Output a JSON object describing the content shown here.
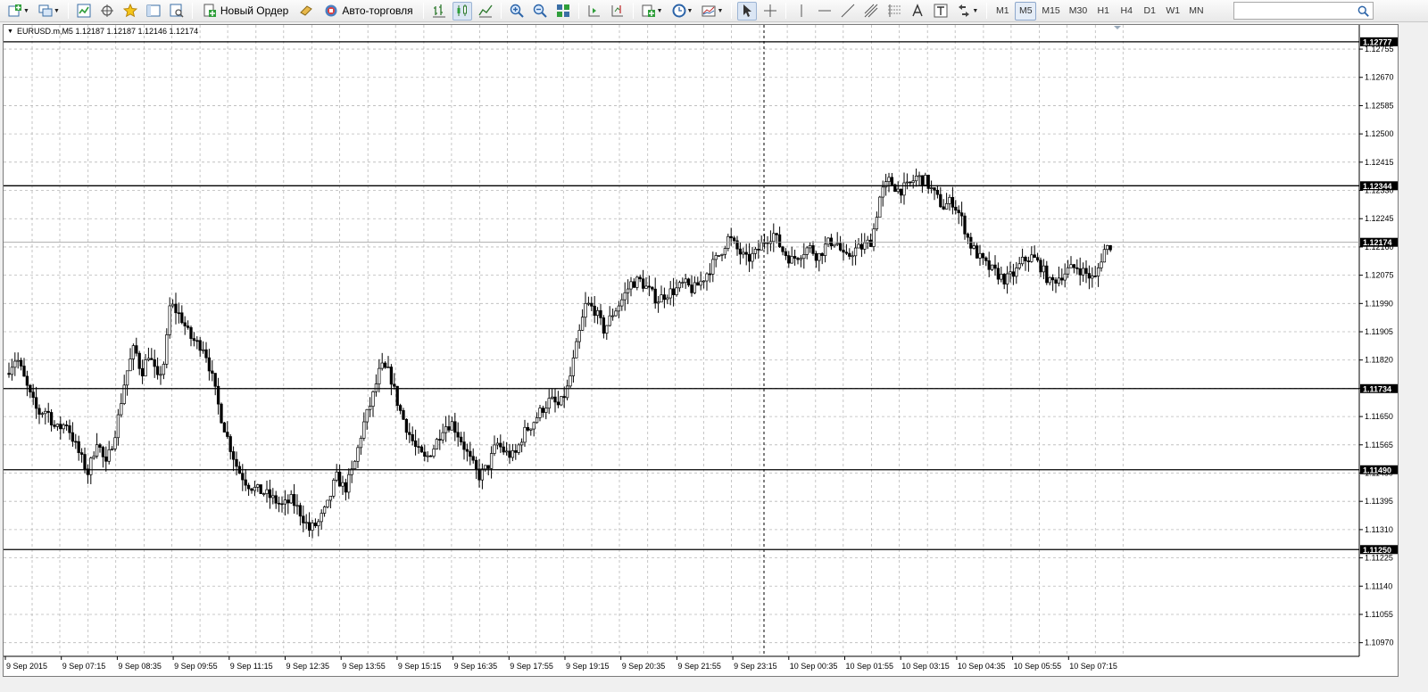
{
  "toolbar": {
    "new_order_label": "Новый Ордер",
    "auto_trading_label": "Авто-торговля",
    "timeframes": [
      "M1",
      "M5",
      "M15",
      "M30",
      "H1",
      "H4",
      "D1",
      "W1",
      "MN"
    ],
    "active_timeframe": "M5"
  },
  "chart": {
    "header_text": "EURUSD.m,M5  1.12187 1.12187 1.12146 1.12174",
    "symbol": "EURUSD.m",
    "timeframe": "M5",
    "ohlc": [
      "1.12187",
      "1.12187",
      "1.12146",
      "1.12174"
    ]
  },
  "chart_data": {
    "type": "candlestick",
    "title": "EURUSD.m,M5",
    "y_axis_ticks": [
      "1.12755",
      "1.12670",
      "1.12585",
      "1.12500",
      "1.12415",
      "1.12330",
      "1.12245",
      "1.12160",
      "1.12075",
      "1.11990",
      "1.11905",
      "1.11820",
      "1.11735",
      "1.11650",
      "1.11565",
      "1.11480",
      "1.11395",
      "1.11310",
      "1.11225",
      "1.11140",
      "1.11055",
      "1.10970"
    ],
    "x_axis_ticks": [
      "9 Sep 2015",
      "9 Sep 07:15",
      "9 Sep 08:35",
      "9 Sep 09:55",
      "9 Sep 11:15",
      "9 Sep 12:35",
      "9 Sep 13:55",
      "9 Sep 15:15",
      "9 Sep 16:35",
      "9 Sep 17:55",
      "9 Sep 19:15",
      "9 Sep 20:35",
      "9 Sep 21:55",
      "9 Sep 23:15",
      "10 Sep 00:35",
      "10 Sep 01:55",
      "10 Sep 03:15",
      "10 Sep 04:35",
      "10 Sep 05:55",
      "10 Sep 07:15"
    ],
    "horizontal_levels": [
      1.12777,
      1.12344,
      1.11734,
      1.1149,
      1.1125
    ],
    "horizontal_level_labels": [
      "1.12777",
      "1.12344",
      "1.11734",
      "1.11490",
      "1.11250"
    ],
    "current_price": 1.12174,
    "current_price_label": "1.12174",
    "ylim": [
      1.10945,
      1.1279
    ],
    "grid": true,
    "price_path": [
      [
        0,
        1.1178
      ],
      [
        12,
        1.1183
      ],
      [
        26,
        1.1172
      ],
      [
        36,
        1.1166
      ],
      [
        46,
        1.1167
      ],
      [
        56,
        1.1161
      ],
      [
        68,
        1.1163
      ],
      [
        80,
        1.1155
      ],
      [
        92,
        1.1148
      ],
      [
        102,
        1.1158
      ],
      [
        112,
        1.115
      ],
      [
        124,
        1.1162
      ],
      [
        134,
        1.1177
      ],
      [
        144,
        1.1186
      ],
      [
        152,
        1.1178
      ],
      [
        160,
        1.1184
      ],
      [
        170,
        1.1176
      ],
      [
        178,
        1.1182
      ],
      [
        184,
        1.1199
      ],
      [
        196,
        1.1195
      ],
      [
        206,
        1.1189
      ],
      [
        214,
        1.1187
      ],
      [
        222,
        1.1186
      ],
      [
        230,
        1.1178
      ],
      [
        240,
        1.1166
      ],
      [
        250,
        1.1157
      ],
      [
        260,
        1.1149
      ],
      [
        270,
        1.1145
      ],
      [
        280,
        1.1143
      ],
      [
        290,
        1.1142
      ],
      [
        300,
        1.114
      ],
      [
        310,
        1.1138
      ],
      [
        320,
        1.114
      ],
      [
        330,
        1.1136
      ],
      [
        340,
        1.1131
      ],
      [
        350,
        1.1133
      ],
      [
        360,
        1.1138
      ],
      [
        370,
        1.1147
      ],
      [
        380,
        1.1143
      ],
      [
        390,
        1.115
      ],
      [
        400,
        1.1162
      ],
      [
        410,
        1.117
      ],
      [
        420,
        1.118
      ],
      [
        430,
        1.1178
      ],
      [
        440,
        1.1168
      ],
      [
        450,
        1.1161
      ],
      [
        460,
        1.1155
      ],
      [
        470,
        1.1152
      ],
      [
        480,
        1.1156
      ],
      [
        490,
        1.1162
      ],
      [
        500,
        1.1163
      ],
      [
        510,
        1.1158
      ],
      [
        520,
        1.1152
      ],
      [
        530,
        1.1147
      ],
      [
        540,
        1.115
      ],
      [
        550,
        1.1157
      ],
      [
        560,
        1.1154
      ],
      [
        570,
        1.1153
      ],
      [
        580,
        1.116
      ],
      [
        590,
        1.1163
      ],
      [
        600,
        1.1167
      ],
      [
        610,
        1.117
      ],
      [
        620,
        1.1168
      ],
      [
        630,
        1.1174
      ],
      [
        640,
        1.1187
      ],
      [
        650,
        1.1199
      ],
      [
        660,
        1.1197
      ],
      [
        670,
        1.1191
      ],
      [
        680,
        1.1196
      ],
      [
        690,
        1.12
      ],
      [
        700,
        1.1205
      ],
      [
        710,
        1.1206
      ],
      [
        720,
        1.1203
      ],
      [
        730,
        1.12
      ],
      [
        740,
        1.1202
      ],
      [
        750,
        1.1203
      ],
      [
        760,
        1.1205
      ],
      [
        770,
        1.1203
      ],
      [
        780,
        1.1206
      ],
      [
        790,
        1.121
      ],
      [
        800,
        1.1214
      ],
      [
        810,
        1.1219
      ],
      [
        820,
        1.1215
      ],
      [
        830,
        1.1212
      ],
      [
        840,
        1.1214
      ],
      [
        850,
        1.1218
      ],
      [
        860,
        1.122
      ],
      [
        870,
        1.1215
      ],
      [
        880,
        1.1212
      ],
      [
        890,
        1.1214
      ],
      [
        900,
        1.1216
      ],
      [
        910,
        1.1213
      ],
      [
        920,
        1.1217
      ],
      [
        930,
        1.1218
      ],
      [
        940,
        1.1212
      ],
      [
        950,
        1.1215
      ],
      [
        960,
        1.1216
      ],
      [
        970,
        1.1218
      ],
      [
        980,
        1.1232
      ],
      [
        990,
        1.1236
      ],
      [
        1000,
        1.1233
      ],
      [
        1010,
        1.1234
      ],
      [
        1020,
        1.1237
      ],
      [
        1030,
        1.1236
      ],
      [
        1040,
        1.1232
      ],
      [
        1050,
        1.1228
      ],
      [
        1060,
        1.123
      ],
      [
        1070,
        1.1225
      ],
      [
        1080,
        1.1217
      ],
      [
        1090,
        1.1213
      ],
      [
        1100,
        1.121
      ],
      [
        1110,
        1.1208
      ],
      [
        1120,
        1.1206
      ],
      [
        1130,
        1.1208
      ],
      [
        1140,
        1.1212
      ],
      [
        1150,
        1.1213
      ],
      [
        1160,
        1.121
      ],
      [
        1170,
        1.1205
      ],
      [
        1180,
        1.1207
      ],
      [
        1190,
        1.1209
      ],
      [
        1200,
        1.121
      ],
      [
        1210,
        1.1208
      ],
      [
        1220,
        1.1206
      ],
      [
        1230,
        1.1215
      ],
      [
        1240,
        1.1217
      ]
    ]
  }
}
